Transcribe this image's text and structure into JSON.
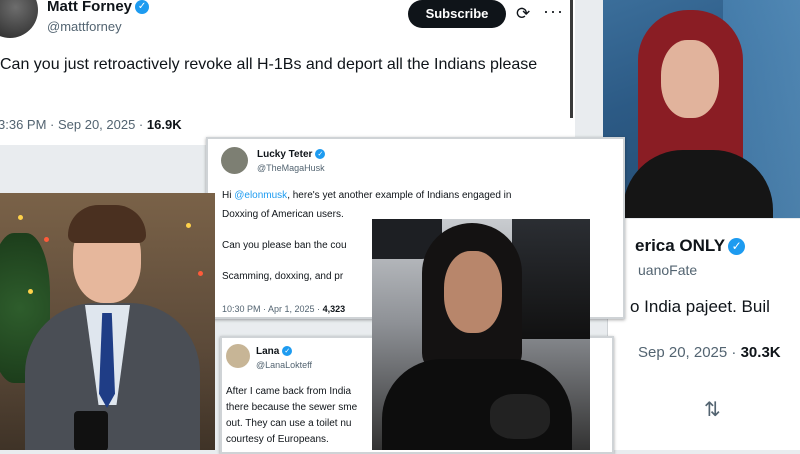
{
  "tweet_main": {
    "name": "Matt Forney",
    "handle": "@mattforney",
    "subscribe_label": "Subscribe",
    "body": "Can you just retroactively revoke all H-1Bs and deport all the Indians please",
    "timestamp": "3:36 PM · Sep 20, 2025 ·",
    "views": "16.9K"
  },
  "tweet_lucky": {
    "name": "Lucky Teter",
    "handle": "@TheMagaHusk",
    "line1_prefix": "Hi",
    "line1_mention": "@elonmusk",
    "line1_rest": ", here's yet another example of Indians engaged in",
    "line2": "Doxxing of American users.",
    "line3": "Can you please ban the cou",
    "line4": "Scamming, doxxing, and pr",
    "timestamp": "10:30 PM · Apr 1, 2025 ·",
    "views": "4,323"
  },
  "tweet_right": {
    "name": "erica ONLY",
    "handle": "uanoFate",
    "body": "o India pajeet. Buil",
    "timestamp": "Sep 20, 2025 ·",
    "views": "30.3K",
    "retweet_icon": "retweet-icon"
  },
  "tweet_lana": {
    "name": "Lana",
    "handle": "@LanaLokteff",
    "line1": "After I came back from India",
    "line2": "there because the sewer sme",
    "line3": "out. They can use a toilet nu",
    "line4": "courtesy of Europeans."
  },
  "colors": {
    "accent": "#1d9bf0",
    "text": "#0f1419",
    "muted": "#536471"
  }
}
